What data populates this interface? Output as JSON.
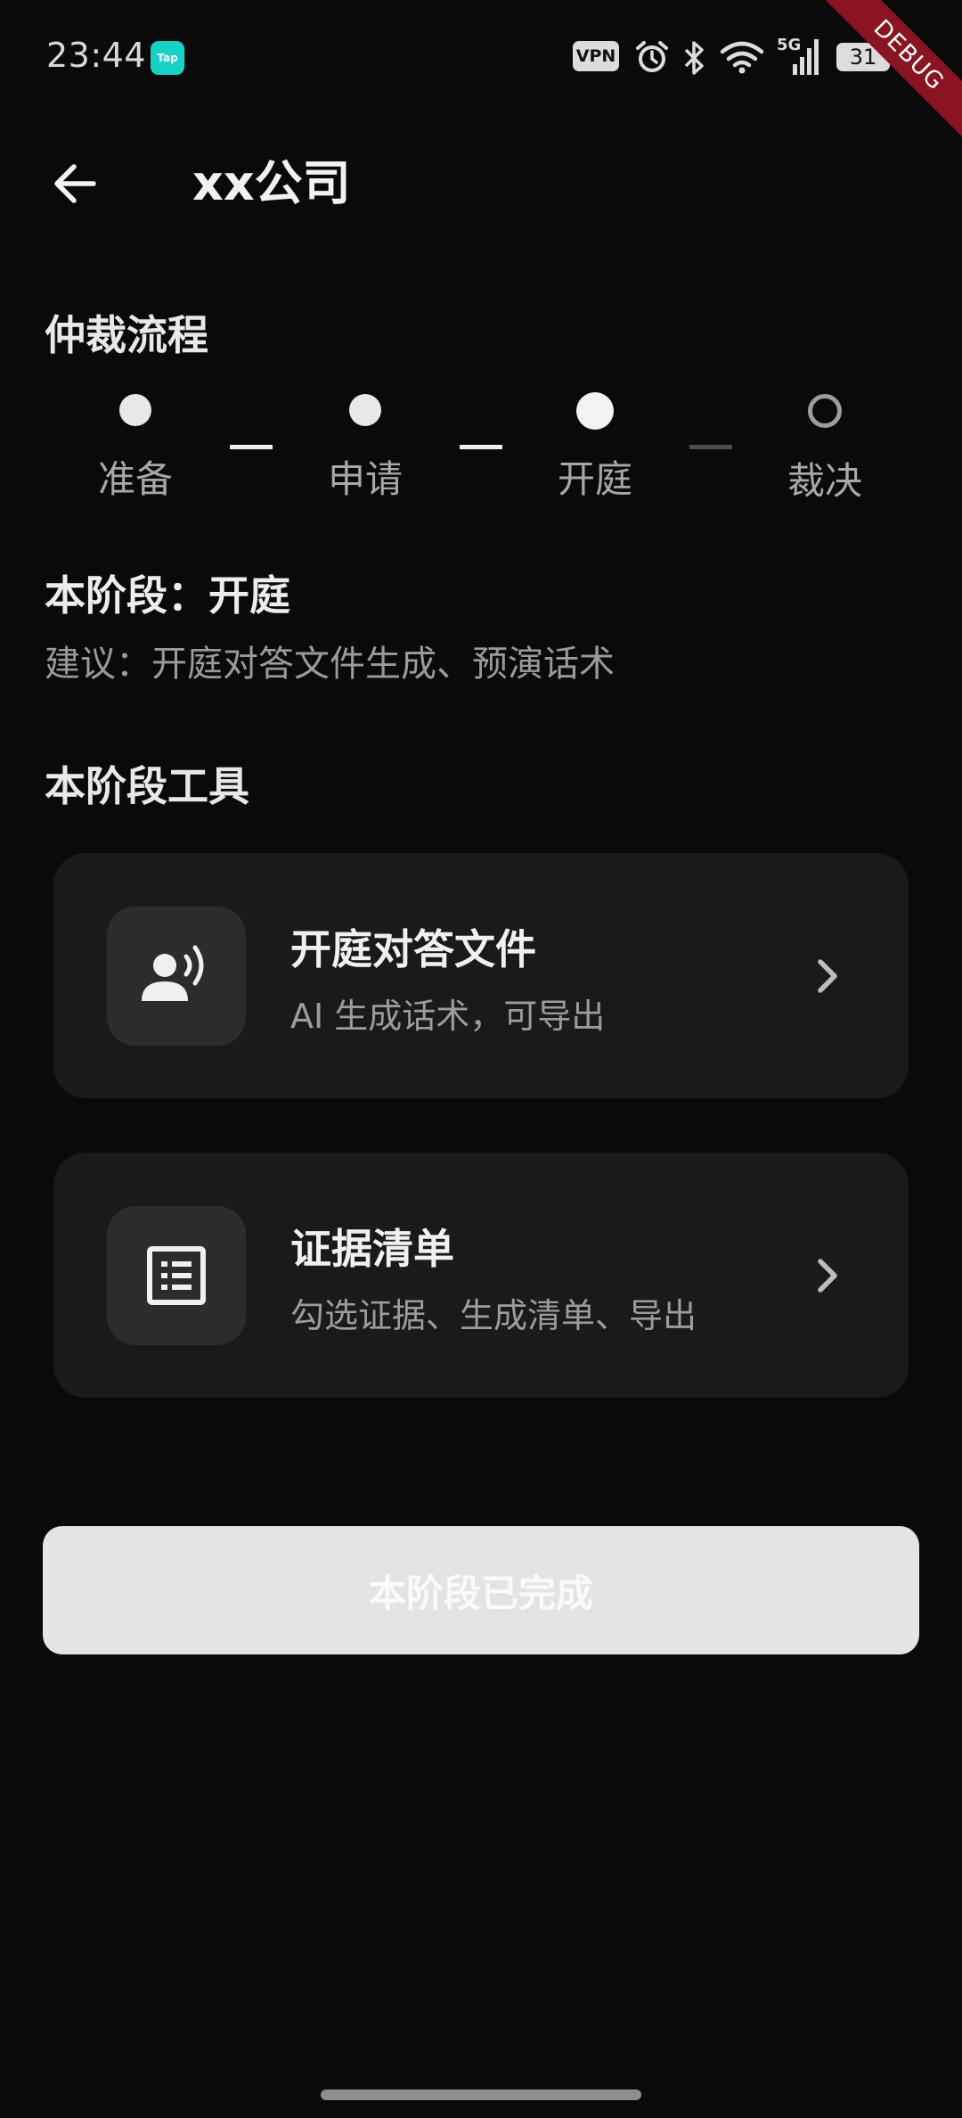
{
  "status_bar": {
    "time": "23:44",
    "app_badge": "Tap",
    "vpn": "VPN",
    "network": "5G",
    "battery": "31",
    "icons": [
      "tap-app-icon",
      "vpn-icon",
      "alarm-icon",
      "bluetooth-icon",
      "wifi-icon",
      "signal-5g-icon",
      "battery-icon"
    ]
  },
  "debug_banner": "DEBUG",
  "app_bar": {
    "title": "xx公司",
    "back_icon": "arrow-left-icon"
  },
  "process": {
    "title": "仲裁流程",
    "steps": [
      {
        "label": "准备",
        "state": "done"
      },
      {
        "label": "申请",
        "state": "done"
      },
      {
        "label": "开庭",
        "state": "current"
      },
      {
        "label": "裁决",
        "state": "pending"
      }
    ]
  },
  "stage": {
    "label": "本阶段：开庭",
    "suggestion": "建议：开庭对答文件生成、预演话术"
  },
  "tools": {
    "title": "本阶段工具",
    "items": [
      {
        "title": "开庭对答文件",
        "subtitle": "AI 生成话术，可导出",
        "icon": "person-speaking-icon"
      },
      {
        "title": "证据清单",
        "subtitle": "勾选证据、生成清单、导出",
        "icon": "list-document-icon"
      }
    ]
  },
  "actions": {
    "complete_label": "本阶段已完成"
  },
  "colors": {
    "background": "#0a0a0b",
    "card": "#1a1a1c",
    "icon_box": "#2c2c2e",
    "button": "#e4e4e4",
    "debug_ribbon": "#8a1520",
    "tap_badge": "#17d0c6"
  }
}
